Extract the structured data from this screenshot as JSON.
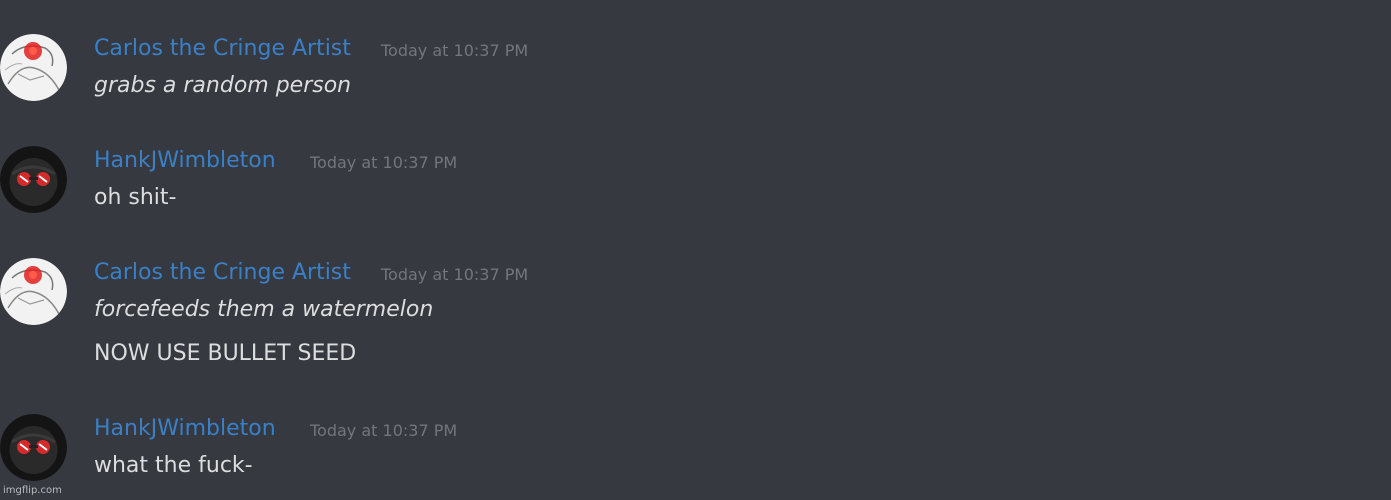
{
  "messages": [
    {
      "author": "Carlos the Cringe Artist",
      "timestamp": "Today at 10:37 PM",
      "avatar_icon": "sketch-character-red-eye-avatar",
      "lines": [
        "grabs a random person"
      ],
      "line_styles": [
        "italic"
      ]
    },
    {
      "author": "HankJWimbleton",
      "timestamp": "Today at 10:37 PM",
      "avatar_icon": "dark-character-red-goggles-avatar",
      "lines": [
        "oh shit-"
      ],
      "line_styles": [
        "normal"
      ]
    },
    {
      "author": "Carlos the Cringe Artist",
      "timestamp": "Today at 10:37 PM",
      "avatar_icon": "sketch-character-red-eye-avatar",
      "lines": [
        "forcefeeds them a watermelon",
        "NOW USE BULLET SEED"
      ],
      "line_styles": [
        "italic",
        "normal"
      ]
    },
    {
      "author": "HankJWimbleton",
      "timestamp": "Today at 10:37 PM",
      "avatar_icon": "dark-character-red-goggles-avatar",
      "lines": [
        "what the fuck-"
      ],
      "line_styles": [
        "normal"
      ]
    }
  ],
  "watermark": "imgflip.com",
  "colors": {
    "background": "#36393f",
    "username": "#3b80c6",
    "timestamp": "#72767d",
    "message_text": "#dcddde"
  }
}
